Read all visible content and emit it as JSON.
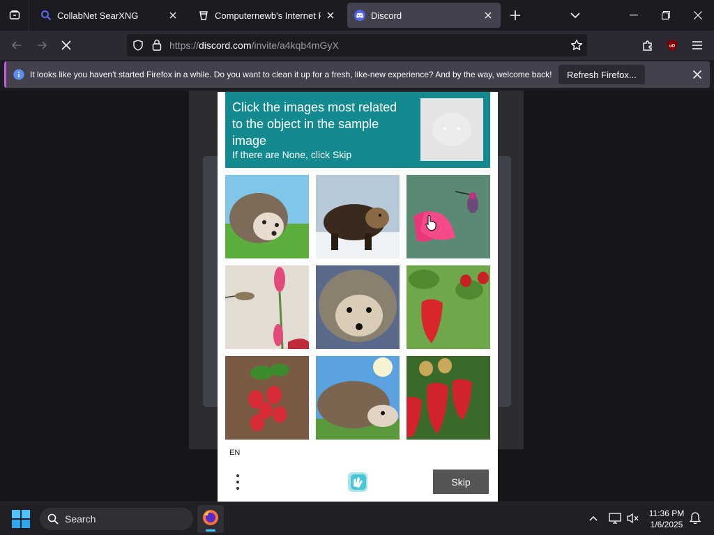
{
  "browser": {
    "tabs": [
      {
        "title": "CollabNet SearXNG",
        "icon": "search-icon",
        "active": false
      },
      {
        "title": "Computernewb's Internet Pub",
        "icon": "pub-icon",
        "active": false
      },
      {
        "title": "Discord",
        "icon": "discord-icon",
        "active": true
      }
    ],
    "url_prefix": "https://",
    "url_host": "discord.com",
    "url_path": "/invite/a4kqb4mGyX",
    "accent_color": "#c45bdf"
  },
  "notification": {
    "message": "It looks like you haven't started Firefox in a while. Do you want to clean it up for a fresh, like-new experience? And by the way, welcome back!",
    "button_label": "Refresh Firefox..."
  },
  "captcha": {
    "prompt_title": "Click the images most related to the object in the sample image",
    "prompt_subtitle": "If there are None, click Skip",
    "header_color": "#128a8f",
    "images": [
      {
        "subject": "hedgehog"
      },
      {
        "subject": "bear"
      },
      {
        "subject": "hummingbird"
      },
      {
        "subject": "hummingbird"
      },
      {
        "subject": "hedgehog"
      },
      {
        "subject": "strawberry"
      },
      {
        "subject": "strawberry"
      },
      {
        "subject": "hedgehog"
      },
      {
        "subject": "strawberry"
      }
    ],
    "language": "EN",
    "skip_label": "Skip"
  },
  "taskbar": {
    "search_label": "Search",
    "time": "11:36 PM",
    "date": "1/6/2025"
  }
}
